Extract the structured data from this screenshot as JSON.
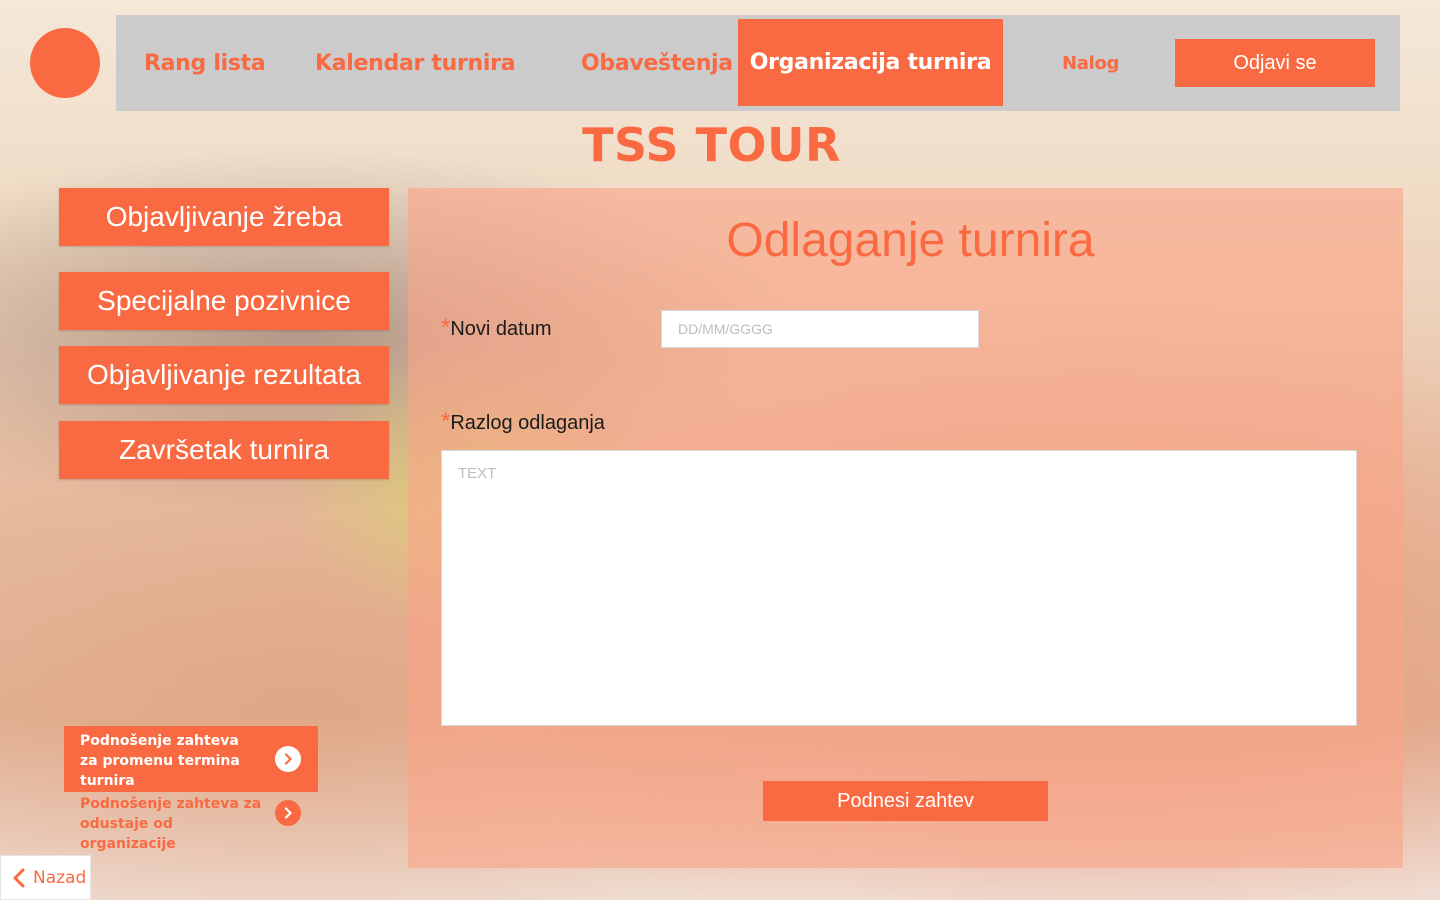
{
  "colors": {
    "accent": "#F96A42",
    "nav_bg": "#CBCBCB"
  },
  "nav": {
    "links": [
      "Rang lista",
      "Kalendar turnira",
      "Obaveštenja"
    ],
    "active": "Organizacija turnira",
    "account": "Nalog",
    "logout": "Odjavi se"
  },
  "brand": {
    "title": "TSS TOUR"
  },
  "sidebar": {
    "buttons": [
      "Objavljivanje žreba",
      "Specijalne pozivnice",
      "Objavljivanje rezultata",
      "Završetak turnira"
    ]
  },
  "form": {
    "title": "Odlaganje turnira",
    "required_mark": "*",
    "date_label": "Novi datum",
    "date_placeholder": "DD/MM/GGGG",
    "reason_label": "Razlog odlaganja",
    "reason_placeholder": "TEXT",
    "submit": "Podnesi zahtev"
  },
  "requests": {
    "items": [
      {
        "label": "Podnošenje zahteva za promenu termina turnira",
        "icon": "chevron-right-icon",
        "active": true
      },
      {
        "label": "Podnošenje zahteva za odustaje od organizacije",
        "icon": "chevron-right-icon",
        "active": false
      }
    ]
  },
  "back": {
    "label": "Nazad",
    "icon": "chevron-left-icon"
  }
}
